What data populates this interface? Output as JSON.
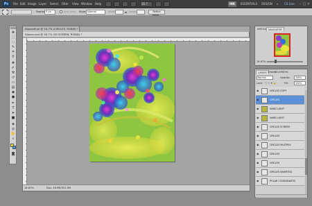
{
  "menubar": {
    "logo": "Ps",
    "items": [
      "File",
      "Edit",
      "Image",
      "Layer",
      "Select",
      "Filter",
      "View",
      "Window",
      "Help"
    ],
    "zoom": "16.7",
    "workspaces": [
      "INK",
      "ESSENTIALS",
      "DESIGN"
    ],
    "more": "»",
    "cs_live": "CS Live"
  },
  "options": {
    "feather_label": "Feather:",
    "feather_value": "0 px",
    "antialias_label": "Anti-alias",
    "style_label": "Style:",
    "style_value": "Normal",
    "width_label": "Width:",
    "height_label": "Height:",
    "refine_label": "Refine Edge..."
  },
  "document": {
    "tab1": "Dioxonfinal @ 16.7% (CIRCLES, RGB/8) *",
    "tab2": "Dioxon.psd @ 16.7% (30 SCREEN, RGB/8) *",
    "status_zoom": "16.67%",
    "status_doc": "Doc: 26.9M/351.9M"
  },
  "navigator": {
    "tabs": [
      "HISTOGRAM",
      "NAVIGATOR"
    ],
    "zoom": "16.67%"
  },
  "layers": {
    "tabs": [
      "LAYERS",
      "CHANNELS",
      "PATHS"
    ],
    "mode": "Normal",
    "opacity_label": "Opacity:",
    "opacity": "100%",
    "fill_label": "Fill:",
    "fill": "100%",
    "lock_label": "Lock:",
    "items": [
      {
        "name": "CIRCLES COPY",
        "selected": false,
        "thumb": "#e8e8e8"
      },
      {
        "name": "CIRCLES",
        "selected": true,
        "thumb": "#e8e8e8"
      },
      {
        "name": "HARD LIGHT",
        "selected": false,
        "thumb": "#b5b53a"
      },
      {
        "name": "HARD LIGHT",
        "selected": false,
        "thumb": "#b5b53a"
      },
      {
        "name": "CIRCLES SCREEN",
        "selected": false,
        "thumb": "#e8e8e8"
      },
      {
        "name": "CIRCLES",
        "selected": false,
        "thumb": "#e8e8e8"
      },
      {
        "name": "CIRCLES MULTIPLY",
        "selected": false,
        "thumb": "#e8e8e8"
      },
      {
        "name": "CIRCLES",
        "selected": false,
        "thumb": "#e8e8e8"
      },
      {
        "name": "CIRCLES",
        "selected": false,
        "thumb": "#e8e8e8"
      },
      {
        "name": "CIRCLES INVERTED",
        "selected": false,
        "thumb": "#e8e8e8"
      },
      {
        "name": "POLAR COORDINATES",
        "selected": false,
        "thumb": "#e8e8e8"
      }
    ]
  },
  "colors": {
    "canvas_bg": "#8ec641",
    "selection_blue": "#5b8fd6"
  }
}
